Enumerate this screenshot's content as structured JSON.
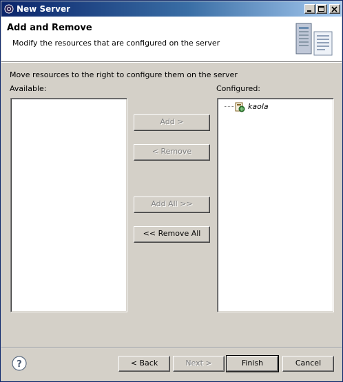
{
  "window": {
    "title": "New Server",
    "title_bar_buttons": [
      "minimize-icon",
      "maximize-icon",
      "close-icon"
    ]
  },
  "banner": {
    "title": "Add and Remove",
    "description": "Modify the resources that are configured on the server",
    "icon": "server-wizard-icon"
  },
  "instruction": "Move resources to the right to configure them on the server",
  "available": {
    "label": "Available:",
    "items": []
  },
  "configured": {
    "label": "Configured:",
    "items": [
      {
        "label": "kaola",
        "icon": "web-module-icon"
      }
    ]
  },
  "actions": {
    "add": {
      "label": "Add >",
      "enabled": false
    },
    "remove": {
      "label": "< Remove",
      "enabled": false
    },
    "add_all": {
      "label": "Add All >>",
      "enabled": false
    },
    "remove_all": {
      "label": "<< Remove All",
      "enabled": true
    }
  },
  "footer": {
    "help_icon": "help-icon",
    "back": {
      "label": "< Back",
      "enabled": true
    },
    "next": {
      "label": "Next >",
      "enabled": false
    },
    "finish": {
      "label": "Finish",
      "enabled": true
    },
    "cancel": {
      "label": "Cancel",
      "enabled": true
    }
  },
  "colors": {
    "title_gradient_start": "#0a246a",
    "title_gradient_end": "#a6caf0",
    "dialog_bg": "#d4d0c8",
    "banner_bg": "#ffffff",
    "disabled_text": "#808080"
  }
}
